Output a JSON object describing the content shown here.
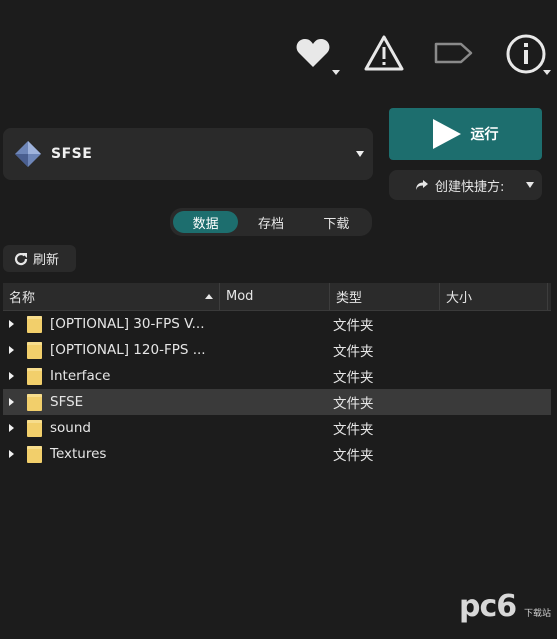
{
  "header_icons": [
    {
      "name": "heart-icon"
    },
    {
      "name": "warning-icon"
    },
    {
      "name": "tag-icon"
    },
    {
      "name": "info-icon"
    }
  ],
  "executable": {
    "name": "SFSE",
    "icon": "sfse-diamond-icon"
  },
  "run_button": {
    "label": "运行",
    "color": "#1d6e6e"
  },
  "shortcut_button": {
    "label": "创建快捷方:"
  },
  "tabs": [
    {
      "label": "数据",
      "active": true
    },
    {
      "label": "存档",
      "active": false
    },
    {
      "label": "下载",
      "active": false
    }
  ],
  "refresh_button": {
    "label": "刷新"
  },
  "table": {
    "columns": [
      "名称",
      "Mod",
      "类型",
      "大小"
    ],
    "rows": [
      {
        "name": "[OPTIONAL] 30-FPS V...",
        "mod": "",
        "type": "文件夹",
        "size": ""
      },
      {
        "name": "[OPTIONAL] 120-FPS ...",
        "mod": "",
        "type": "文件夹",
        "size": ""
      },
      {
        "name": "Interface",
        "mod": "",
        "type": "文件夹",
        "size": ""
      },
      {
        "name": "SFSE",
        "mod": "",
        "type": "文件夹",
        "size": ""
      },
      {
        "name": "sound",
        "mod": "",
        "type": "文件夹",
        "size": ""
      },
      {
        "name": "Textures",
        "mod": "",
        "type": "文件夹",
        "size": ""
      }
    ],
    "selected_row": 3
  },
  "watermark": {
    "logo_text": "pc6",
    "sub_text": "下载站"
  }
}
